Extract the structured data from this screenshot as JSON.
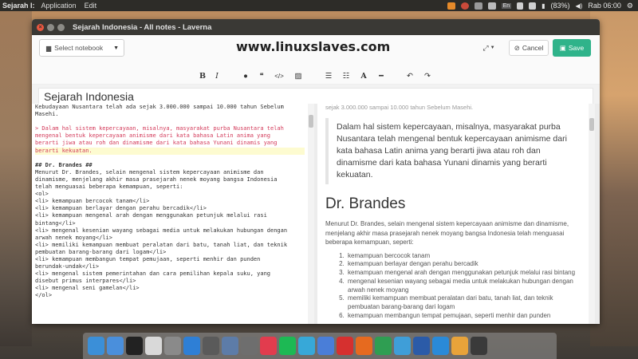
{
  "topbar": {
    "app_name": "Sejarah I:",
    "menus": [
      "Application",
      "Edit"
    ],
    "battery": "(83%)",
    "lang": "En",
    "clock": "Rab 06:00"
  },
  "window": {
    "title": "Sejarah Indonesia - All notes - Laverna"
  },
  "toolbar": {
    "notebook_placeholder": "Select notebook",
    "site_title": "www.linuxslaves.com",
    "cancel_label": "Cancel",
    "save_label": "Save"
  },
  "format_bar": {
    "bold": "B",
    "italic": "I",
    "heading": "A"
  },
  "note": {
    "title": "Sejarah Indonesia"
  },
  "editor": {
    "lines": [
      {
        "text": "Kebudayaan Nusantara telah ada sejak 3.000.000 sampai 10.000 tahun Sebelum",
        "cls": ""
      },
      {
        "text": "Masehi.",
        "cls": ""
      },
      {
        "text": "",
        "cls": ""
      },
      {
        "text": "> Dalam hal sistem kepercayaan, misalnya, masyarakat purba Nusantara telah",
        "cls": "quote"
      },
      {
        "text": "mengenal bentuk kepercayaan animisme dari kata bahasa Latin anima yang",
        "cls": "quote"
      },
      {
        "text": "berarti jiwa atau roh dan dinamisme dari kata bahasa Yunani dinamis yang",
        "cls": "quote"
      },
      {
        "text": "berarti kekuatan.",
        "cls": "quote hl"
      },
      {
        "text": "",
        "cls": ""
      },
      {
        "text": "## Dr. Brandes ##",
        "cls": "head"
      },
      {
        "text": "Menurut Dr. Brandes, selain mengenal sistem kepercayaan animisme dan",
        "cls": ""
      },
      {
        "text": "dinamisme, menjelang akhir masa prasejarah nenek moyang bangsa Indonesia",
        "cls": ""
      },
      {
        "text": "telah menguasai beberapa kemampuan, seperti:",
        "cls": ""
      },
      {
        "text": "<ol>",
        "cls": ""
      },
      {
        "text": "<li> kemampuan bercocok tanam</li>",
        "cls": ""
      },
      {
        "text": "<li> kemampuan berlayar dengan perahu bercadik</li>",
        "cls": ""
      },
      {
        "text": "<li> kemampuan mengenal arah dengan menggunakan petunjuk melalui rasi",
        "cls": ""
      },
      {
        "text": "bintang</li>",
        "cls": ""
      },
      {
        "text": "<li> mengenal kesenian wayang sebagai media untuk melakukan hubungan dengan",
        "cls": ""
      },
      {
        "text": "arwah nenek moyang</li>",
        "cls": ""
      },
      {
        "text": "<li> memiliki kemampuan membuat peralatan dari batu, tanah liat, dan teknik",
        "cls": ""
      },
      {
        "text": "pembuatan barang-barang dari logam</li>",
        "cls": ""
      },
      {
        "text": "<li> kemampuan membangun tempat pemujaan, seperti menhir dan punden",
        "cls": ""
      },
      {
        "text": "berundak-undak</li>",
        "cls": ""
      },
      {
        "text": "<li> mengenal sistem pemerintahan dan cara pemilihan kepala suku, yang",
        "cls": ""
      },
      {
        "text": "disebut primus interpares</li>",
        "cls": ""
      },
      {
        "text": "<li> mengenal seni gamelan</li>",
        "cls": ""
      },
      {
        "text": "</ol>",
        "cls": ""
      }
    ]
  },
  "preview": {
    "cut_line": "sejak 3.000.000 sampai 10.000 tahun Sebelum Masehi.",
    "quote": "Dalam hal sistem kepercayaan, misalnya, masyarakat purba Nusantara telah mengenal bentuk kepercayaan animisme dari kata bahasa Latin anima yang berarti jiwa atau roh dan dinamisme dari kata bahasa Yunani dinamis yang berarti kekuatan.",
    "heading": "Dr. Brandes",
    "paragraph": "Menurut Dr. Brandes, selain mengenal sistem kepercayaan animisme dan dinamisme, menjelang akhir masa prasejarah nenek moyang bangsa Indonesia telah menguasai beberapa kemampuan, seperti:",
    "items": [
      "kemampuan bercocok tanam",
      "kemampuan berlayar dengan perahu bercadik",
      "kemampuan mengenal arah dengan menggunakan petunjuk melalui rasi bintang",
      "mengenal kesenian wayang sebagai media untuk melakukan hubungan dengan arwah nenek moyang",
      "memiliki kemampuan membuat peralatan dari batu, tanah liat, dan teknik pembuatan barang-barang dari logam",
      "kemampuan membangun tempat pemujaan, seperti menhir dan punden"
    ]
  },
  "dock": {
    "apps": [
      {
        "name": "finder-icon",
        "color": "#3b8fd8"
      },
      {
        "name": "launchpad-icon",
        "color": "#4a8fdc"
      },
      {
        "name": "terminal-icon",
        "color": "#222222"
      },
      {
        "name": "notes-app-icon",
        "color": "#d9d9d9"
      },
      {
        "name": "disk-icon",
        "color": "#8a8a8a"
      },
      {
        "name": "dropbox-icon",
        "color": "#2e7fd6"
      },
      {
        "name": "system-icon",
        "color": "#5a5a5a"
      },
      {
        "name": "atom-icon",
        "color": "#5d7ca8"
      },
      {
        "name": "code-icon",
        "color": "#6e6e6e"
      },
      {
        "name": "music-icon",
        "color": "#e23c4e"
      },
      {
        "name": "spotify-icon",
        "color": "#1db954"
      },
      {
        "name": "chat-icon",
        "color": "#37a8d8"
      },
      {
        "name": "pencil-icon",
        "color": "#4a7ed8"
      },
      {
        "name": "opera-icon",
        "color": "#d6302f"
      },
      {
        "name": "firefox-icon",
        "color": "#e66a1f"
      },
      {
        "name": "chrome-icon",
        "color": "#2f9e52"
      },
      {
        "name": "settings-icon",
        "color": "#3f9ed8"
      },
      {
        "name": "word-icon",
        "color": "#2b5ba8"
      },
      {
        "name": "sync-icon",
        "color": "#2a8ad8"
      },
      {
        "name": "photos-icon",
        "color": "#e8a33a"
      },
      {
        "name": "video-icon",
        "color": "#3a3a3a"
      }
    ]
  }
}
